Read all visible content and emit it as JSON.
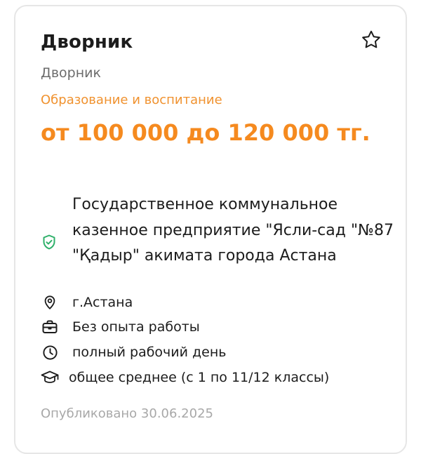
{
  "vacancy": {
    "title": "Дворник",
    "subtitle": "Дворник",
    "category": "Образование и воспитание",
    "salary": "от 100 000 до 120 000 тг.",
    "employer": "Государственное коммунальное казенное предприятие \"Ясли-сад \"№87 \"Қадыр\" акимата города Астана",
    "location": "г.Астана",
    "experience": "Без опыта работы",
    "schedule": "полный рабочий день",
    "education": "общее среднее (с 1 по 11/12 классы)",
    "published": "Опубликовано 30.06.2025"
  },
  "icons": {
    "favorite": "star-outline-icon",
    "employer_verified": "shield-check-icon",
    "location": "map-pin-icon",
    "experience": "briefcase-icon",
    "schedule": "clock-icon",
    "education": "graduation-cap-icon"
  },
  "colors": {
    "accent": "#f58a1f",
    "category": "#f0922f",
    "verified": "#2fb06a",
    "muted": "#a8a8a8",
    "text": "#1c1c1c"
  }
}
